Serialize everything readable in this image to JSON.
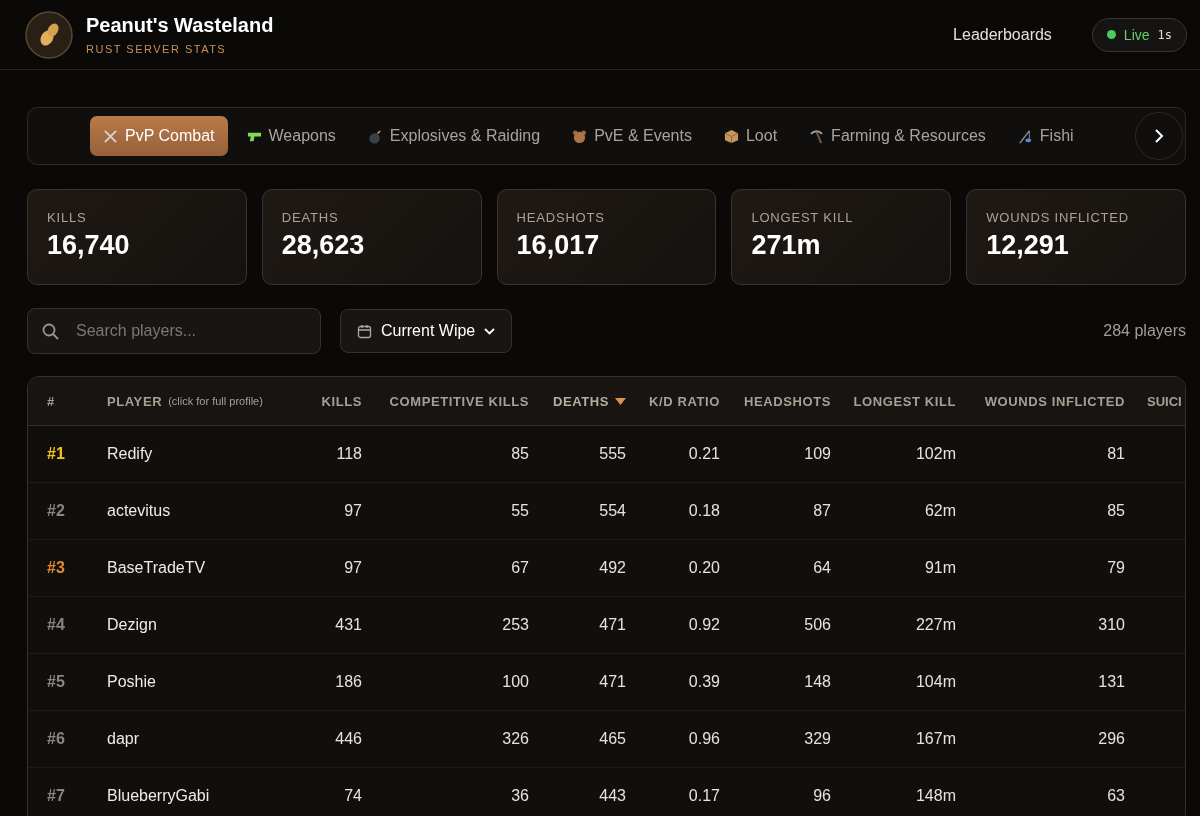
{
  "header": {
    "title": "Peanut's Wasteland",
    "subtitle": "RUST SERVER STATS",
    "nav_link": "Leaderboards",
    "live": {
      "label": "Live",
      "on": true,
      "age": "1s"
    }
  },
  "tabs": [
    {
      "label": "PvP Combat",
      "selected": true
    },
    {
      "label": "Weapons",
      "selected": false
    },
    {
      "label": "Explosives & Raiding",
      "selected": false
    },
    {
      "label": "PvE & Events",
      "selected": false
    },
    {
      "label": "Loot",
      "selected": false
    },
    {
      "label": "Farming & Resources",
      "selected": false
    },
    {
      "label": "Fishi",
      "selected": false
    }
  ],
  "stats": [
    {
      "label": "KILLS",
      "value": "16,740"
    },
    {
      "label": "DEATHS",
      "value": "28,623"
    },
    {
      "label": "HEADSHOTS",
      "value": "16,017"
    },
    {
      "label": "LONGEST KILL",
      "value": "271m"
    },
    {
      "label": "WOUNDS INFLICTED",
      "value": "12,291"
    }
  ],
  "search": {
    "placeholder": "Search players..."
  },
  "period_filter": "Current Wipe",
  "player_count": "284 players",
  "table": {
    "columns": [
      {
        "label": "#",
        "sorted": false
      },
      {
        "label": "PLAYER",
        "note": "(click for full profile)",
        "sorted": false
      },
      {
        "label": "KILLS",
        "sorted": false
      },
      {
        "label": "COMPETITIVE KILLS",
        "sorted": false
      },
      {
        "label": "DEATHS",
        "sorted": true
      },
      {
        "label": "K/D RATIO",
        "sorted": false
      },
      {
        "label": "HEADSHOTS",
        "sorted": false
      },
      {
        "label": "LONGEST KILL",
        "sorted": false
      },
      {
        "label": "WOUNDS INFLICTED",
        "sorted": false
      },
      {
        "label": "SUICI",
        "sorted": false
      }
    ],
    "rows": [
      {
        "color": "#f5c518",
        "cells": [
          "#1",
          "Redify",
          "118",
          "85",
          "555",
          "0.21",
          "109",
          "102m",
          "81"
        ]
      },
      {
        "color": "#8a8580",
        "cells": [
          "#2",
          "actevitus",
          "97",
          "55",
          "554",
          "0.18",
          "87",
          "62m",
          "85"
        ]
      },
      {
        "color": "#e08a2c",
        "cells": [
          "#3",
          "BaseTradeTV",
          "97",
          "67",
          "492",
          "0.20",
          "64",
          "91m",
          "79"
        ]
      },
      {
        "color": "#8a8580",
        "cells": [
          "#4",
          "Dezign",
          "431",
          "253",
          "471",
          "0.92",
          "506",
          "227m",
          "310"
        ]
      },
      {
        "color": "#8a8580",
        "cells": [
          "#5",
          "Poshie",
          "186",
          "100",
          "471",
          "0.39",
          "148",
          "104m",
          "131"
        ]
      },
      {
        "color": "#8a8580",
        "cells": [
          "#6",
          "dapr",
          "446",
          "326",
          "465",
          "0.96",
          "329",
          "167m",
          "296"
        ]
      },
      {
        "color": "#8a8580",
        "cells": [
          "#7",
          "BlueberryGabi",
          "74",
          "36",
          "443",
          "0.17",
          "96",
          "148m",
          "63"
        ]
      }
    ]
  }
}
